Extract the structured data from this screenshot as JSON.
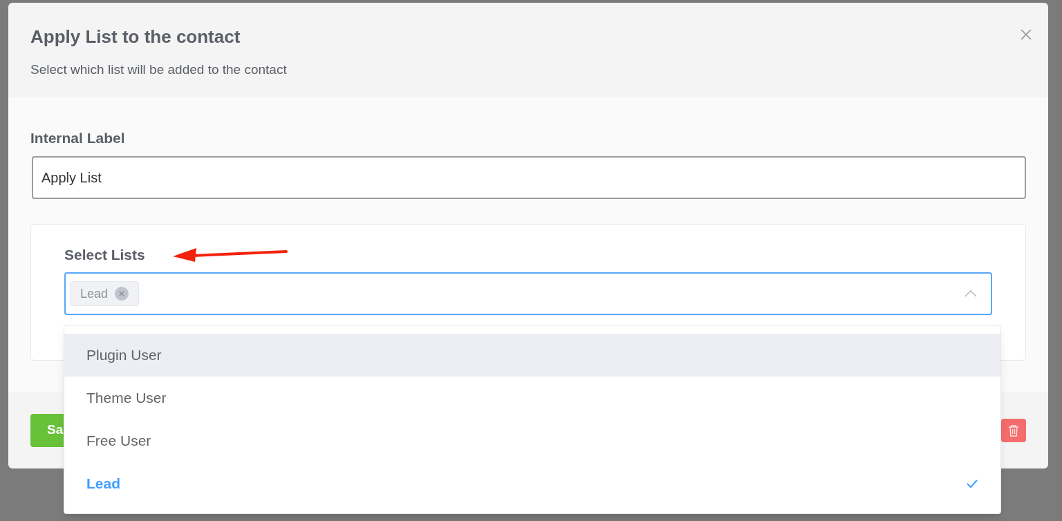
{
  "modal": {
    "title": "Apply List to the contact",
    "subtitle": "Select which list will be added to the contact",
    "internal_label": {
      "label": "Internal Label",
      "value": "Apply List"
    },
    "select_lists": {
      "label": "Select Lists",
      "tags": [
        "Lead"
      ],
      "expanded": true,
      "options": [
        {
          "label": "Plugin User",
          "selected": false,
          "hovered": true
        },
        {
          "label": "Theme User",
          "selected": false,
          "hovered": false
        },
        {
          "label": "Free User",
          "selected": false,
          "hovered": false
        },
        {
          "label": "Lead",
          "selected": true,
          "hovered": false
        }
      ]
    },
    "save_button": "Sa"
  }
}
